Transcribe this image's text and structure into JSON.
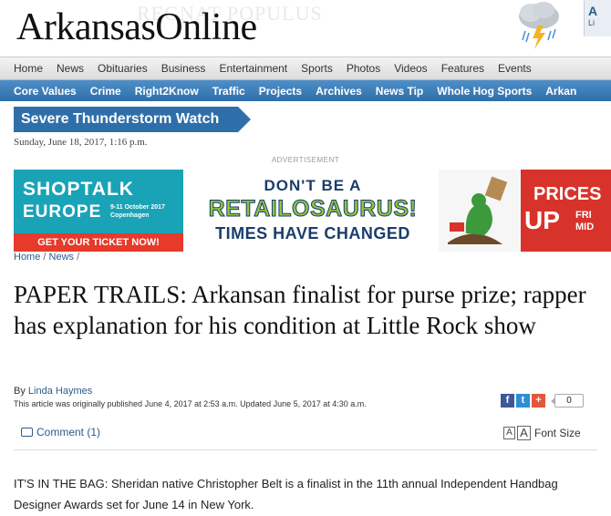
{
  "site": {
    "logo": "ArkansasOnline",
    "logo_ghost": "REGNAT   POPULUS"
  },
  "weather": {
    "tab_label": "A",
    "tab_sub": "Li"
  },
  "nav_primary": [
    "Home",
    "News",
    "Obituaries",
    "Business",
    "Entertainment",
    "Sports",
    "Photos",
    "Videos",
    "Features",
    "Events"
  ],
  "nav_secondary": [
    "Core Values",
    "Crime",
    "Right2Know",
    "Traffic",
    "Projects",
    "Archives",
    "News Tip",
    "Whole Hog Sports",
    "Arkan"
  ],
  "alert": "Severe Thunderstorm Watch",
  "date": "Sunday, June 18, 2017, 1:16 p.m.",
  "ad_label": "ADVERTISEMENT",
  "ads": {
    "shoptalk": {
      "line1": "SHOPTALK",
      "line2": "EUROPE",
      "detail": "9-11 October 2017 Copenhagen",
      "cta": "GET YOUR TICKET NOW!"
    },
    "retail": {
      "line1": "DON'T BE A",
      "line2": "RETAILOSAURUS!",
      "line3": "TIMES HAVE CHANGED"
    },
    "prices": {
      "line1": "PRICES",
      "line2": "UP",
      "line3": "FRI MID"
    }
  },
  "breadcrumb": {
    "home": "Home",
    "sep": "/",
    "section": "News",
    "sep2": "/"
  },
  "headline": "PAPER TRAILS: Arkansan finalist for purse prize; rapper has explanation for his condition at Little Rock show",
  "byline": {
    "prefix": "By",
    "author": "Linda Haymes"
  },
  "published": "This article was originally published June 4, 2017 at 2:53 a.m. Updated June 5, 2017 at 4:30 a.m.",
  "share": {
    "fb": "f",
    "tw": "t",
    "gp": "+",
    "count": "0"
  },
  "tools": {
    "comment": "Comment (1)",
    "font_small": "A",
    "font_large": "A",
    "font_label": "Font Size"
  },
  "body": "IT'S IN THE BAG: Sheridan native Christopher Belt is a finalist in the 11th annual Independent Handbag Designer Awards set for June 14 in New York."
}
